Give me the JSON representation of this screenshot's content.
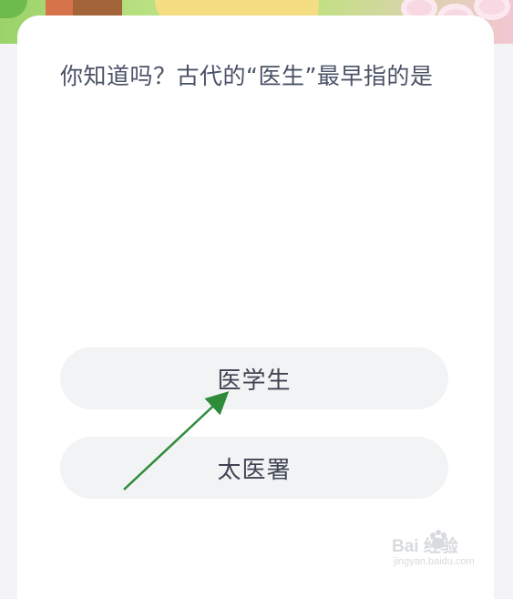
{
  "question": {
    "text": "你知道吗？古代的“医生”最早指的是"
  },
  "options": [
    {
      "label": "医学生"
    },
    {
      "label": "太医署"
    }
  ],
  "watermark": {
    "brand": "Bai 经验",
    "url": "jingyan.baidu.com"
  },
  "colors": {
    "card_bg": "#ffffff",
    "option_bg": "#f2f3f5",
    "question_text": "#4a5266",
    "arrow": "#2e8b3a"
  }
}
